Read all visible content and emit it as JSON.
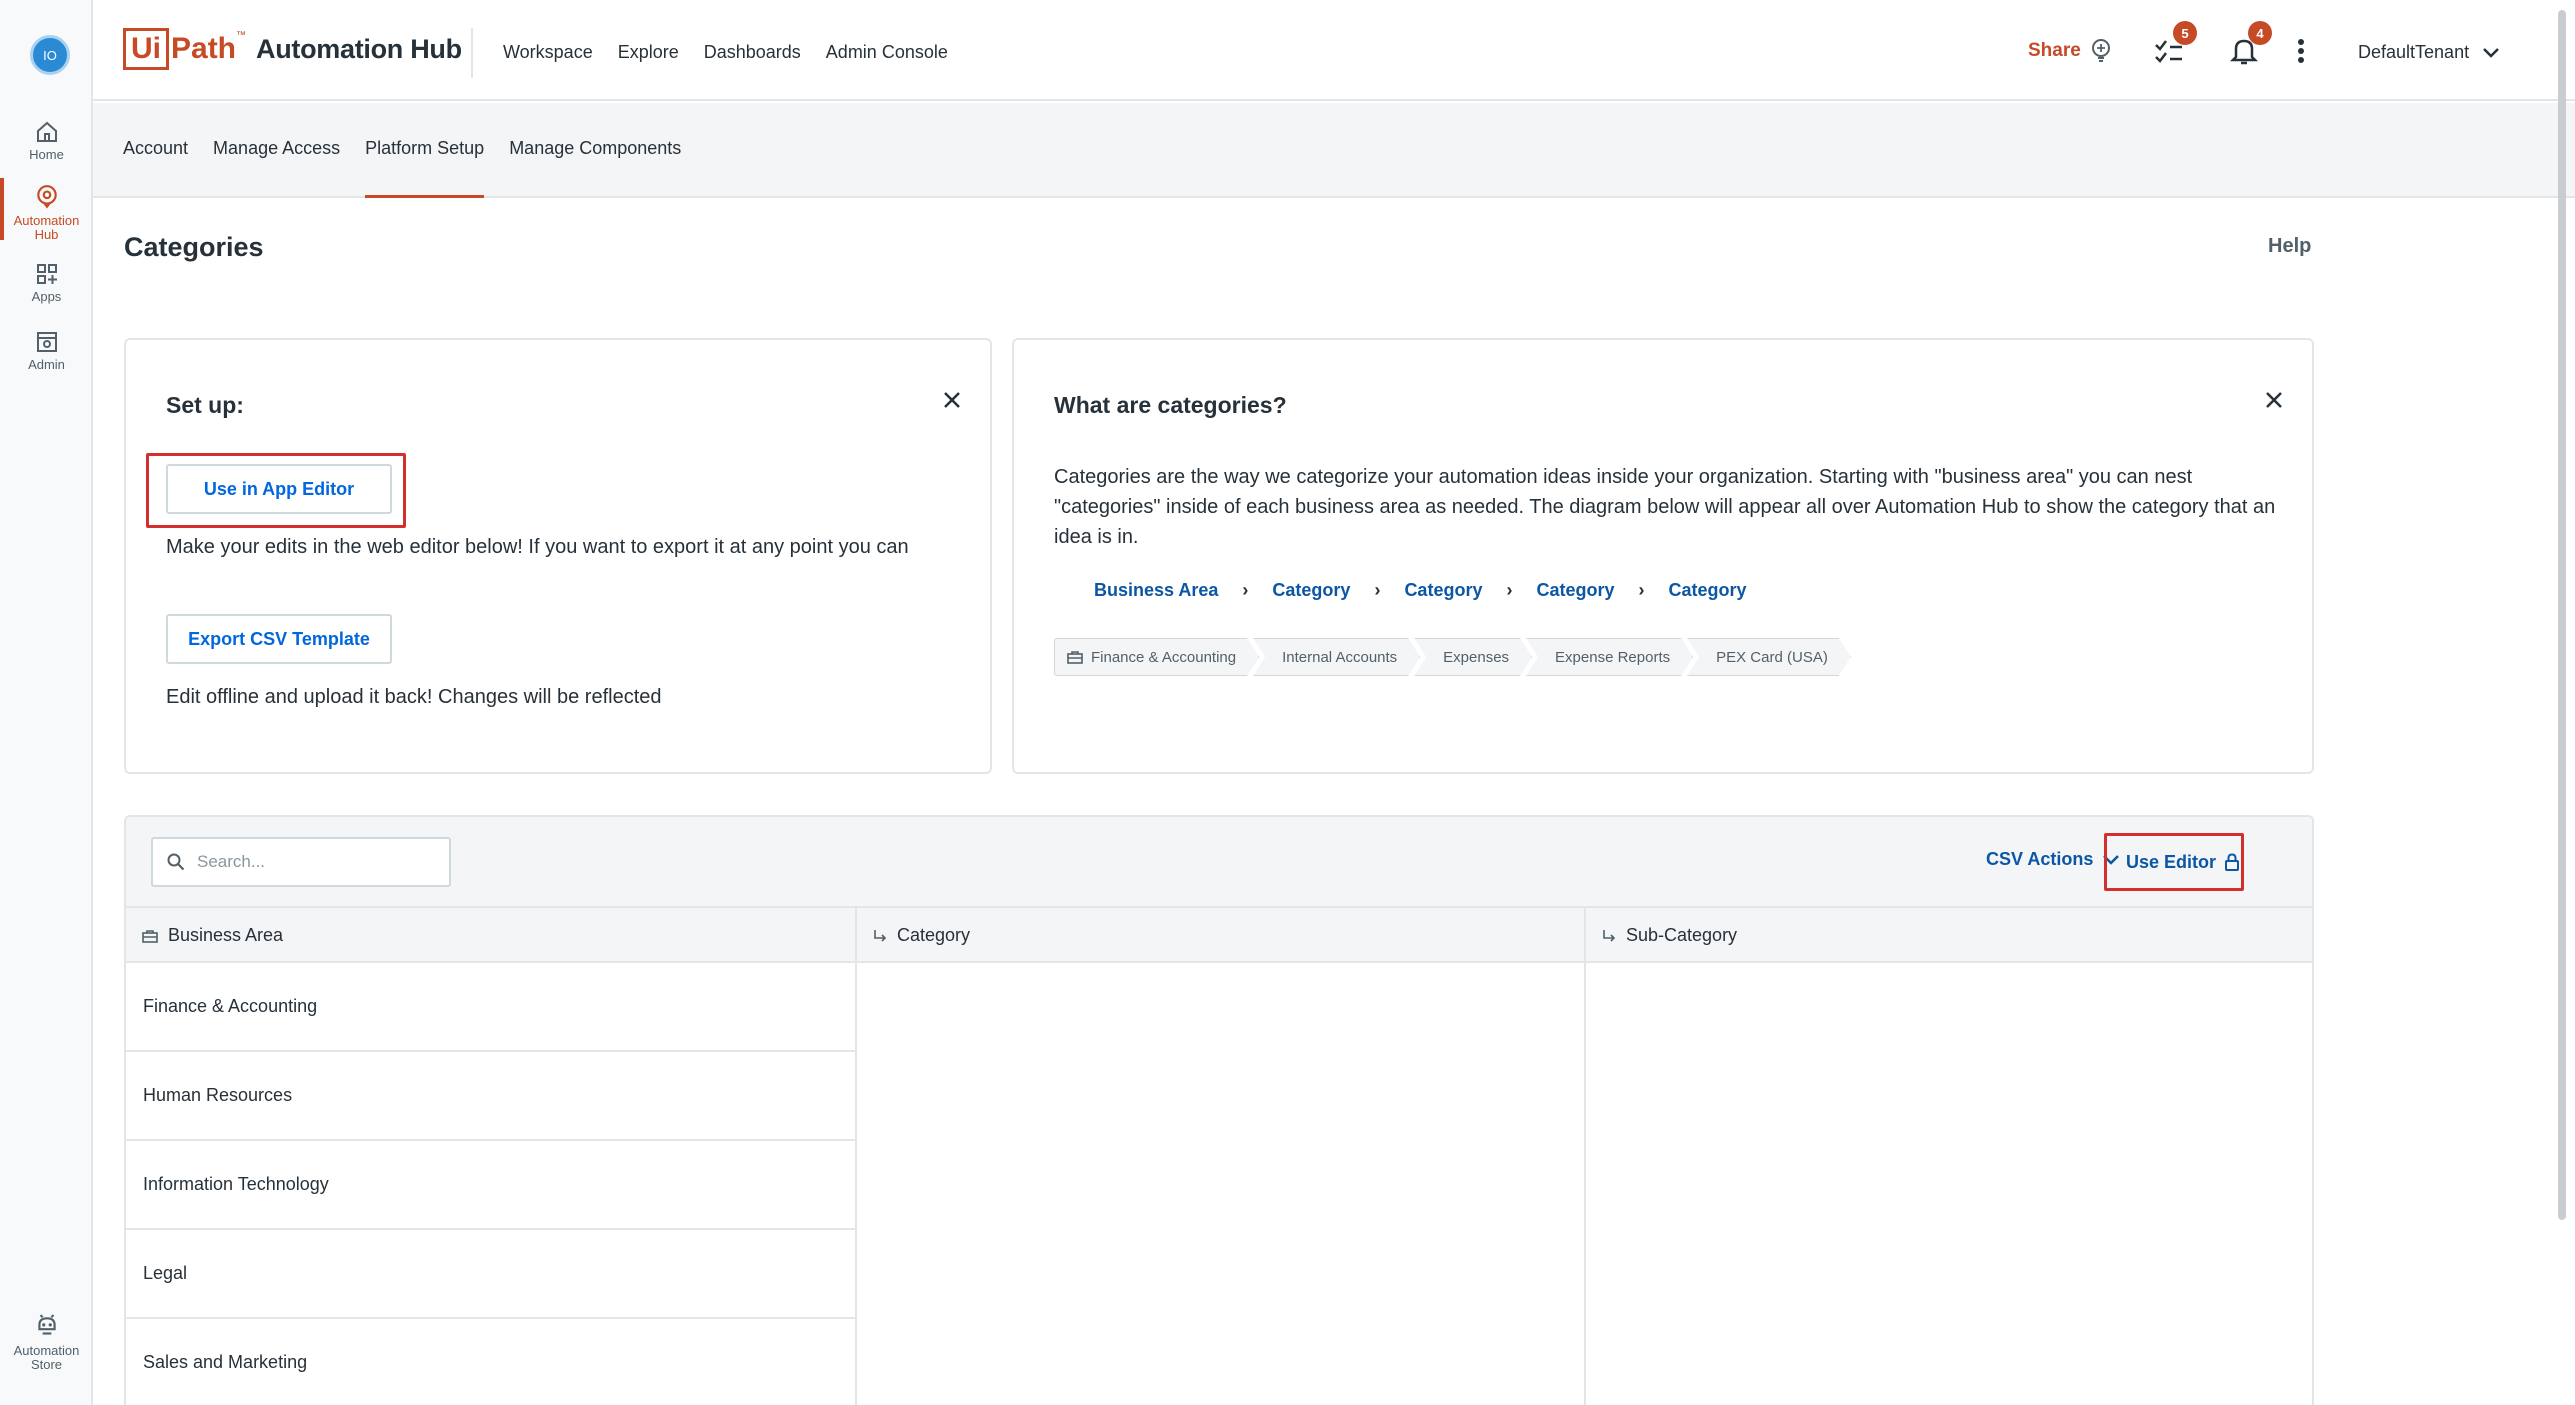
{
  "app": {
    "avatar_initials": "IO",
    "logo_box": "Ui",
    "logo_path": "Path",
    "logo_tm": "™",
    "product": "Automation Hub"
  },
  "rail": {
    "items": [
      {
        "label": "Home",
        "icon": "home-icon"
      },
      {
        "label": "Automation Hub",
        "icon": "automation-hub-icon",
        "active": true
      },
      {
        "label": "Apps",
        "icon": "apps-icon"
      },
      {
        "label": "Admin",
        "icon": "admin-icon"
      },
      {
        "label": "Automation Store",
        "icon": "automation-store-icon"
      }
    ]
  },
  "topnav": {
    "items": [
      "Workspace",
      "Explore",
      "Dashboards",
      "Admin Console"
    ],
    "share_label": "Share",
    "tasks_badge": "5",
    "notifications_badge": "4",
    "tenant": "DefaultTenant"
  },
  "subnav": {
    "tabs": [
      "Account",
      "Manage Access",
      "Platform Setup",
      "Manage Components"
    ],
    "active": "Platform Setup"
  },
  "page": {
    "title": "Categories",
    "help": "Help"
  },
  "setup_card": {
    "title": "Set up:",
    "app_editor_button": "Use in App Editor",
    "app_editor_text": "Make your edits in the web editor below! If you want to export it at any point you can",
    "export_button": "Export CSV Template",
    "export_text": "Edit offline and upload it back! Changes will be reflected"
  },
  "what_card": {
    "title": "What are categories?",
    "description": "Categories are the way we categorize your automation ideas inside your organization. Starting with \"business area\" you can nest \"categories\" inside of each business area as needed. The diagram below will appear all over Automation Hub to show the category that an idea is in.",
    "hierarchy": [
      "Business Area",
      "Category",
      "Category",
      "Category",
      "Category"
    ],
    "example_chips": [
      "Finance & Accounting",
      "Internal Accounts",
      "Expenses",
      "Expense Reports",
      "PEX Card (USA)"
    ]
  },
  "table": {
    "search_placeholder": "Search...",
    "csv_actions": "CSV Actions",
    "use_editor": "Use Editor",
    "columns": [
      "Business Area",
      "Category",
      "Sub-Category"
    ],
    "rows": [
      "Finance & Accounting",
      "Human Resources",
      "Information Technology",
      "Legal",
      "Sales and Marketing"
    ]
  },
  "colors": {
    "brand": "#c74a26",
    "link": "#0b57a3",
    "highlight": "#d32f2f"
  }
}
